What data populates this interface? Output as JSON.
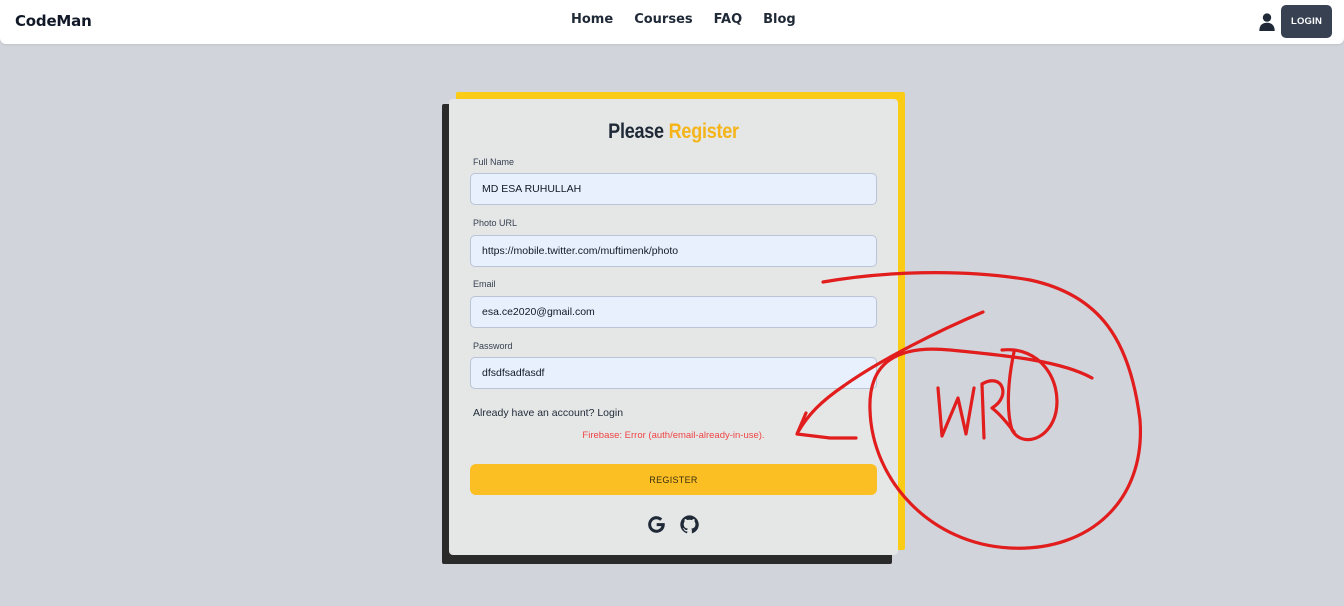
{
  "nav": {
    "brand": "CodeMan",
    "links": [
      "Home",
      "Courses",
      "FAQ",
      "Blog"
    ],
    "login_label": "LOGIN",
    "user_icon": "user-icon"
  },
  "form": {
    "title_part1": "Please",
    "title_part2": "Register",
    "fields": [
      {
        "label": "Full Name",
        "value": "MD ESA RUHULLAH"
      },
      {
        "label": "Photo URL",
        "value": "https://mobile.twitter.com/muftimenk/photo"
      },
      {
        "label": "Email",
        "value": "esa.ce2020@gmail.com"
      },
      {
        "label": "Password",
        "value": "dfsdfsadfasdf"
      }
    ],
    "account_prompt": "Already have an account?",
    "account_link": "Login",
    "error": "Firebase: Error (auth/email-already-in-use).",
    "register_label": "REGISTER",
    "social_icons": [
      "google-icon",
      "github-icon"
    ]
  },
  "colors": {
    "accent_yellow": "#fbbf24",
    "title_gold": "#f4b41a",
    "error_red": "#ef4444",
    "annotation_red": "#e11d1d",
    "background": "#d1d5db",
    "login_button": "#374151"
  }
}
